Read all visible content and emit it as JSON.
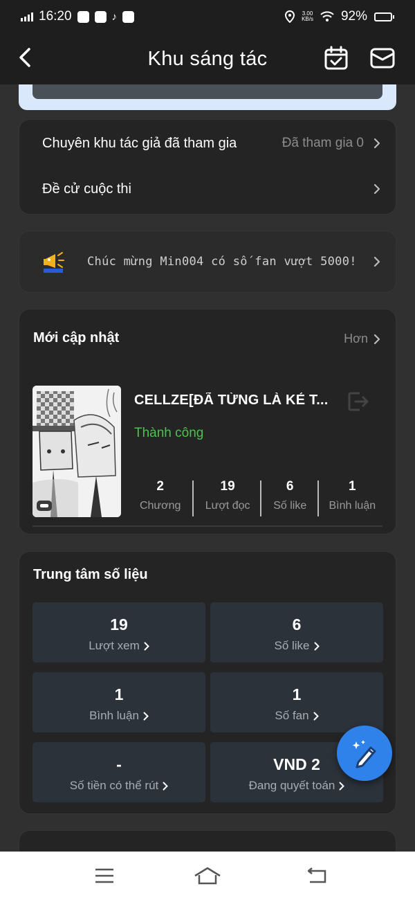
{
  "status_bar": {
    "time": "16:20",
    "net_speed_value": "3.00",
    "net_speed_unit": "KB/s",
    "battery": "92%",
    "battery_level": 0.92
  },
  "header": {
    "title": "Khu sáng tác",
    "icons": [
      "back-arrow-icon",
      "calendar-check-icon",
      "mail-icon"
    ]
  },
  "menu": {
    "joined_label": "Chuyên khu tác giả đã tham gia",
    "joined_value": "Đã tham gia 0",
    "contest_label": "Đề cử cuộc thi"
  },
  "announcement": {
    "text": "Chúc mừng Min004 có số fan vượt 5000!"
  },
  "recent": {
    "title": "Mới cập nhật",
    "more_label": "Hơn",
    "book": {
      "title": "CELLZE[ĐÃ TỪNG LÀ KẺ T...",
      "status": "Thành công",
      "stats": [
        {
          "value": "2",
          "label": "Chương"
        },
        {
          "value": "19",
          "label": "Lượt đọc"
        },
        {
          "value": "6",
          "label": "Số like"
        },
        {
          "value": "1",
          "label": "Bình luận"
        }
      ]
    }
  },
  "data_center": {
    "title": "Trung tâm số liệu",
    "tiles": [
      {
        "value": "19",
        "label": "Lượt xem"
      },
      {
        "value": "6",
        "label": "Số like"
      },
      {
        "value": "1",
        "label": "Bình luận"
      },
      {
        "value": "1",
        "label": "Số fan"
      },
      {
        "value": "-",
        "label": "Số tiền có thể rút"
      },
      {
        "value": "VND 2",
        "label": "Đang quyết toán"
      }
    ]
  },
  "colors": {
    "accent": "#2f82ea",
    "success": "#4cc24c",
    "card": "#242424",
    "background": "#303030"
  }
}
